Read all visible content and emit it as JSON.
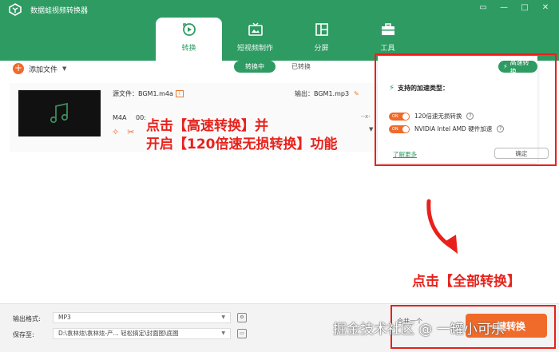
{
  "app": {
    "title": "数据蛙视频转换器"
  },
  "window_controls": [
    "▭",
    "—",
    "□",
    "✕"
  ],
  "tabs": [
    {
      "label": "转换",
      "icon": "convert-icon",
      "active": true
    },
    {
      "label": "短视频制作",
      "icon": "tv-icon",
      "active": false
    },
    {
      "label": "分屏",
      "icon": "split-screen-icon",
      "active": false
    },
    {
      "label": "工具",
      "icon": "toolbox-icon",
      "active": false
    }
  ],
  "toolbar": {
    "add_file": "添加文件",
    "segment_converting": "转换中",
    "segment_converted": "已转换"
  },
  "file": {
    "source": "源文件：BGM1.m4a",
    "output": "输出：BGM1.mp3",
    "format": "M4A",
    "duration": "00:",
    "range": "--x-"
  },
  "popup": {
    "high_speed_btn": "高速转换",
    "title": "支持的加速类型：",
    "option1_toggle": "ON",
    "option1_label": "120倍速无损转换",
    "option2_toggle": "ON",
    "option2_label": "NVIDIA  Intel  AMD  硬件加速",
    "learn_more": "了解更多",
    "ok": "确定"
  },
  "annotations": {
    "line1": "点击【高速转换】并",
    "line2": "开启【120倍速无损转换】功能",
    "line3": "点击【全部转换】"
  },
  "bottom": {
    "format_label": "输出格式:",
    "format_value": "MP3",
    "save_label": "保存至:",
    "save_value": "D:\\袁林炫\\袁林炫-产...    轻松搞定\\封面图\\底图",
    "merge": "合并一个",
    "convert_all": "一键转换"
  },
  "watermark": "掘金技术社区 @ 一罐小可乐",
  "colors": {
    "brand": "#2e9b63",
    "accent": "#f06a2a",
    "annotation": "#e8211b"
  }
}
